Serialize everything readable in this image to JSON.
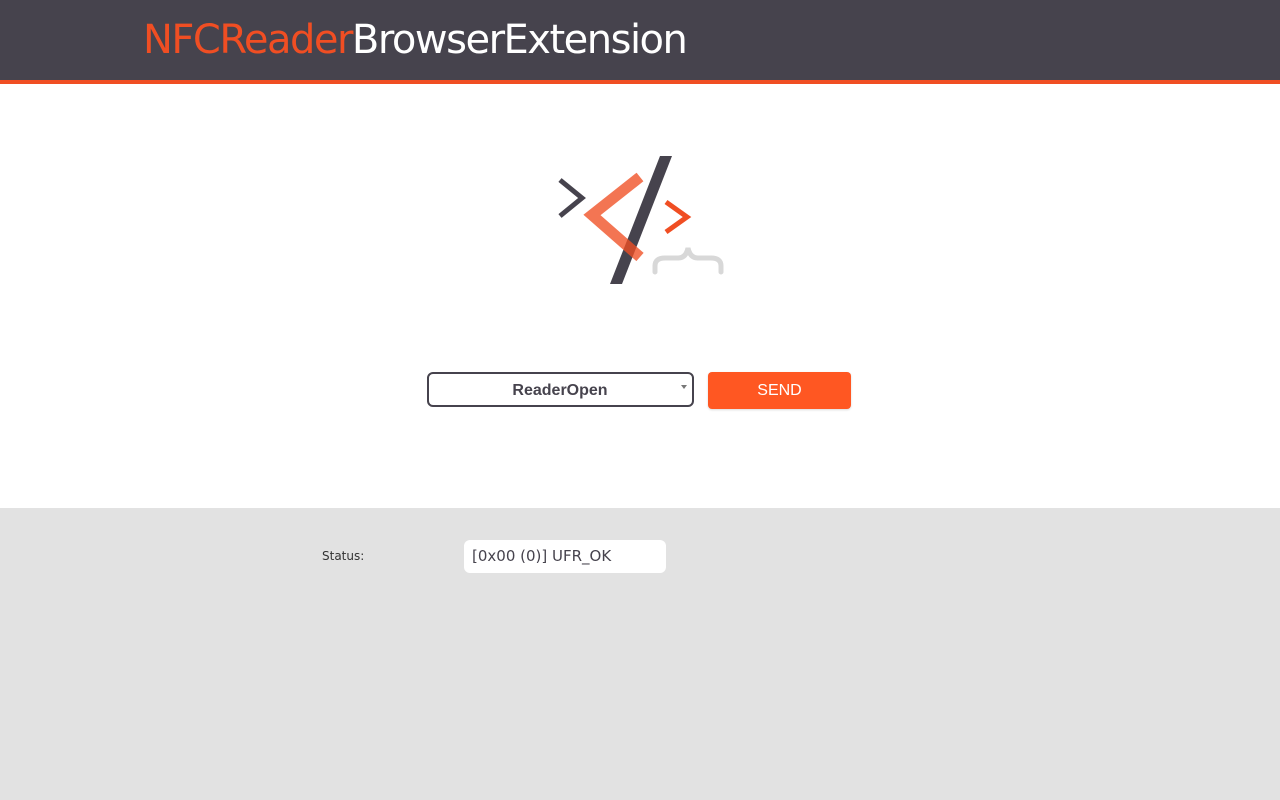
{
  "header": {
    "title_accent": "NFCReader",
    "title_rest": "BrowserExtension"
  },
  "logo": {
    "icon": "code-brackets-logo-icon"
  },
  "controls": {
    "command_select_value": "ReaderOpen",
    "send_label": "SEND"
  },
  "status": {
    "label": "Status:",
    "value": "[0x00 (0)] UFR_OK"
  },
  "colors": {
    "header_bg": "#46434d",
    "accent": "#f04e23",
    "send_button": "#ff5722",
    "panel_bg": "#e2e2e2"
  }
}
